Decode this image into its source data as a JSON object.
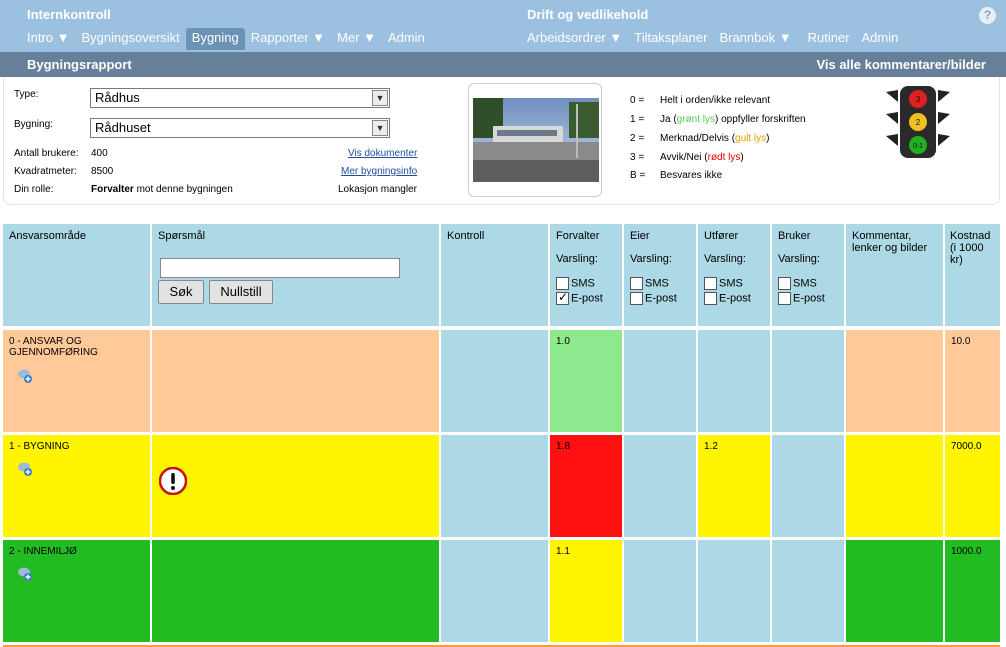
{
  "topnav": {
    "left_title": "Internkontroll",
    "right_title": "Drift og vedlikehold",
    "help": "?",
    "left_items": [
      {
        "label": "Intro ▼"
      },
      {
        "label": "Bygningsoversikt"
      },
      {
        "label": "Bygning"
      },
      {
        "label": "Rapporter ▼"
      },
      {
        "label": "Mer ▼"
      },
      {
        "label": "Admin"
      }
    ],
    "right_items": [
      {
        "label": "Arbeidsordrer ▼"
      },
      {
        "label": "Tiltaksplaner"
      },
      {
        "label": "Brannbok ▼"
      },
      {
        "label": "Rutiner"
      },
      {
        "label": "Admin"
      }
    ]
  },
  "subbar": {
    "title": "Bygningsrapport",
    "action": "Vis alle kommentarer/bilder"
  },
  "info": {
    "type_label": "Type:",
    "type_value": "Rådhus",
    "building_label": "Bygning:",
    "building_value": "Rådhuset",
    "users_label": "Antall brukere:",
    "users_value": "400",
    "area_label": "Kvadratmeter:",
    "area_value": "8500",
    "role_label": "Din rolle:",
    "role_value": "Forvalter",
    "role_suffix": "mot denne bygningen",
    "link_docs": "Vis dokumenter",
    "link_info": "Mer bygningsinfo",
    "location": "Lokasjon mangler"
  },
  "legend": [
    {
      "key": "0 =",
      "text": "Helt i orden/ikke relevant",
      "hl": "",
      "after": ""
    },
    {
      "key": "1 =",
      "text": "Ja (",
      "hl": "grønt lys",
      "after": ") oppfyller forskriften",
      "color": "#55cc55"
    },
    {
      "key": "2 =",
      "text": "Merknad/Delvis (",
      "hl": "gult lys",
      "after": ")",
      "color": "#e0a000"
    },
    {
      "key": "3 =",
      "text": "Avvik/Nei (",
      "hl": "rødt lys",
      "after": ")",
      "color": "#ee0000"
    },
    {
      "key": "B =",
      "text": "Besvares ikke",
      "hl": "",
      "after": ""
    }
  ],
  "traffic_light": {
    "top": "3",
    "middle": "2",
    "bottom": "0-1"
  },
  "table": {
    "headers": {
      "area": "Ansvarsområde",
      "question": "Spørsmål",
      "control": "Kontroll",
      "forvalter": "Forvalter",
      "eier": "Eier",
      "utforer": "Utfører",
      "bruker": "Bruker",
      "comments": "Kommentar, lenker og bilder",
      "cost": "Kostnad (i 1000 kr)"
    },
    "varsling": "Varsling:",
    "sms": "SMS",
    "epost": "E-post",
    "search_button": "Søk",
    "reset_button": "Nullstill",
    "rows": [
      {
        "area": "0 - ANSVAR OG GJENNOMFØRING",
        "forvalter": "1.0",
        "eier": "",
        "utforer": "",
        "bruker": "",
        "cost": "10.0"
      },
      {
        "area": "1 - BYGNING",
        "forvalter": "1.8",
        "eier": "",
        "utforer": "1.2",
        "bruker": "",
        "cost": "7000.0"
      },
      {
        "area": "2 - INNEMILJØ",
        "forvalter": "1.1",
        "eier": "",
        "utforer": "",
        "bruker": "",
        "cost": "1000.0"
      }
    ]
  },
  "colors": {
    "header_blue": "#9cc0e0",
    "subbar": "#668099",
    "cell_blue": "#add8e6",
    "orange": "#ffc999",
    "yellow": "#fff500",
    "green": "#22bb22",
    "light_green": "#8ee88e",
    "red": "#ff1111"
  }
}
